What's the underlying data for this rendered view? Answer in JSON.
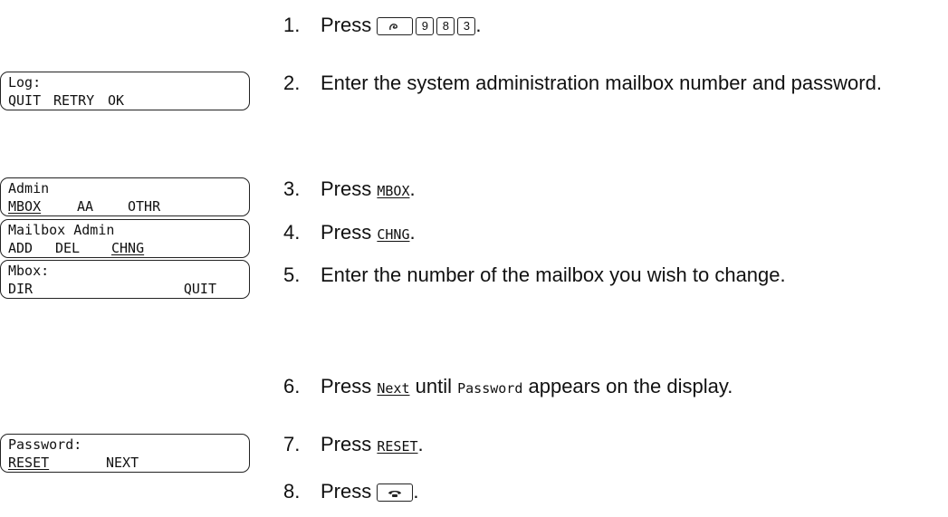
{
  "displays": {
    "log": {
      "line1": "Log:",
      "keys": [
        "QUIT",
        "RETRY",
        "OK"
      ]
    },
    "admin": {
      "line1": "Admin",
      "keys": [
        "MBOX",
        "AA",
        "OTHR"
      ]
    },
    "mailbox_admin": {
      "line1": "Mailbox Admin",
      "keys": [
        "ADD",
        "DEL",
        "CHNG"
      ]
    },
    "mbox": {
      "line1": "Mbox:",
      "keys": [
        "DIR",
        "QUIT"
      ]
    },
    "password": {
      "line1": "Password:",
      "keys": [
        "RESET",
        "NEXT"
      ]
    }
  },
  "steps": [
    {
      "num": "1.",
      "prefix": "Press",
      "keys": [
        "9",
        "8",
        "3"
      ],
      "suffix": "."
    },
    {
      "num": "2.",
      "text": "Enter the system administration mailbox number and password."
    },
    {
      "num": "3.",
      "prefix": "Press",
      "softkey": "MBOX",
      "suffix": "."
    },
    {
      "num": "4.",
      "prefix": "Press",
      "softkey": "CHNG",
      "suffix": "."
    },
    {
      "num": "5.",
      "text": "Enter the number of the mailbox you wish to change."
    },
    {
      "num": "6.",
      "prefix": "Press",
      "softkey": "Next",
      "middle": "until",
      "display_word": "Password",
      "suffix": "appears on the display."
    },
    {
      "num": "7.",
      "prefix": "Press",
      "softkey": "RESET",
      "suffix": "."
    },
    {
      "num": "8.",
      "prefix": "Press",
      "suffix": "."
    }
  ],
  "icons": {
    "feature": "feature-key-icon",
    "release": "release-key-icon"
  }
}
